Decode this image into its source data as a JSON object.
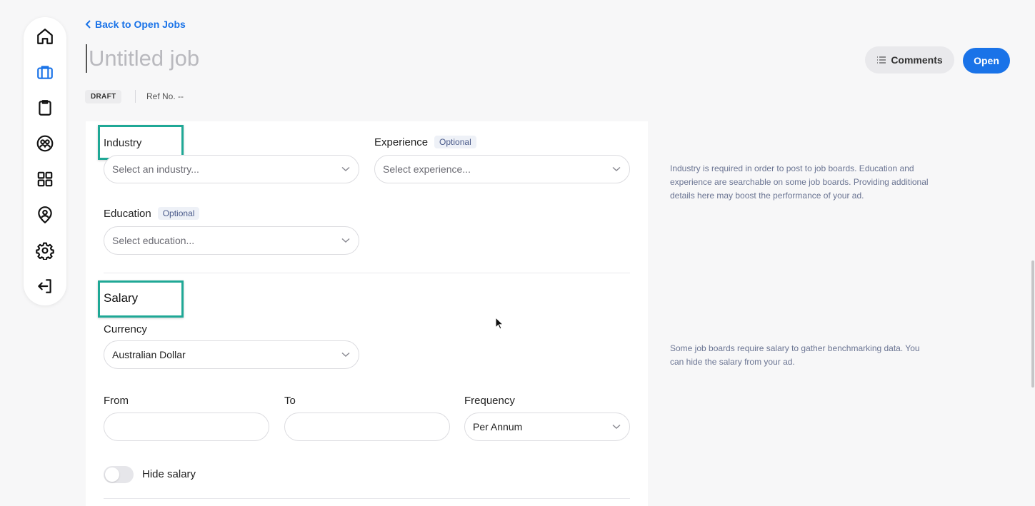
{
  "sidebar": {
    "items": [
      {
        "name": "home",
        "icon": "home-icon"
      },
      {
        "name": "jobs",
        "icon": "briefcase-icon",
        "active": true
      },
      {
        "name": "clipboard",
        "icon": "clipboard-icon"
      },
      {
        "name": "people",
        "icon": "people-icon"
      },
      {
        "name": "apps",
        "icon": "grid-icon"
      },
      {
        "name": "profile",
        "icon": "user-pin-icon"
      },
      {
        "name": "settings",
        "icon": "gear-icon"
      },
      {
        "name": "logout",
        "icon": "logout-icon"
      }
    ]
  },
  "header": {
    "back_label": "Back to Open Jobs",
    "title_placeholder": "Untitled job",
    "status_badge": "DRAFT",
    "ref_label": "Ref No. --",
    "comments_label": "Comments",
    "open_label": "Open"
  },
  "details": {
    "industry_label": "Industry",
    "industry_placeholder": "Select an industry...",
    "experience_label": "Experience",
    "experience_optional": "Optional",
    "experience_placeholder": "Select experience...",
    "education_label": "Education",
    "education_optional": "Optional",
    "education_placeholder": "Select education...",
    "hint": "Industry is required in order to post to job boards. Education and experience are searchable on some job boards. Providing additional details here may boost the performance of your ad."
  },
  "salary": {
    "section_title": "Salary",
    "currency_label": "Currency",
    "currency_value": "Australian Dollar",
    "from_label": "From",
    "from_value": "",
    "to_label": "To",
    "to_value": "",
    "frequency_label": "Frequency",
    "frequency_value": "Per Annum",
    "hide_label": "Hide salary",
    "hide_enabled": false,
    "hint": "Some job boards require salary to gather benchmarking data. You can hide the salary from your ad."
  },
  "colors": {
    "accent": "#1a73e8",
    "highlight": "#1fa896",
    "background": "#f7f7f8"
  }
}
